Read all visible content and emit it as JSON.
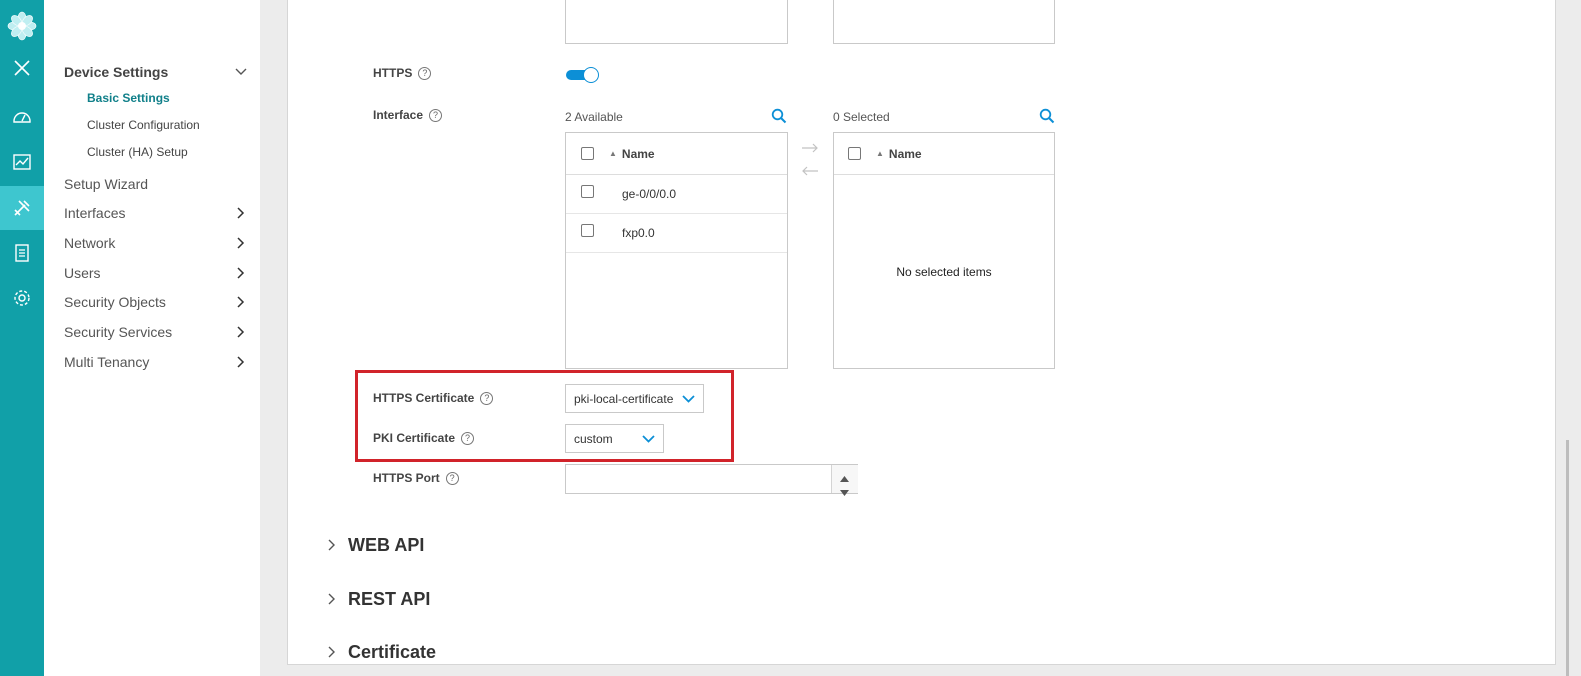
{
  "rail": {
    "icons": [
      "flower-logo-icon",
      "close-icon",
      "dashboard-icon",
      "monitor-icon",
      "tools-icon",
      "reports-icon",
      "gear-icon"
    ]
  },
  "nav": {
    "device_settings": "Device Settings",
    "subs": [
      "Basic Settings",
      "Cluster Configuration",
      "Cluster (HA) Setup"
    ],
    "items": [
      "Setup Wizard",
      "Interfaces",
      "Network",
      "Users",
      "Security Objects",
      "Security Services",
      "Multi Tenancy"
    ]
  },
  "form": {
    "https_label": "HTTPS",
    "https_enabled": true,
    "interface_label": "Interface",
    "available_count": "2 Available",
    "selected_count": "0 Selected",
    "name_header": "Name",
    "available_items": [
      "ge-0/0/0.0",
      "fxp0.0"
    ],
    "empty_text": "No selected items",
    "https_cert_label": "HTTPS Certificate",
    "https_cert_value": "pki-local-certificate",
    "pki_cert_label": "PKI Certificate",
    "pki_cert_value": "custom",
    "https_port_label": "HTTPS Port",
    "https_port_value": ""
  },
  "sections": [
    "WEB API",
    "REST API",
    "Certificate"
  ],
  "colors": {
    "rail": "#11a0a8",
    "accent": "#0c8fd6",
    "highlight": "#d1232a"
  }
}
